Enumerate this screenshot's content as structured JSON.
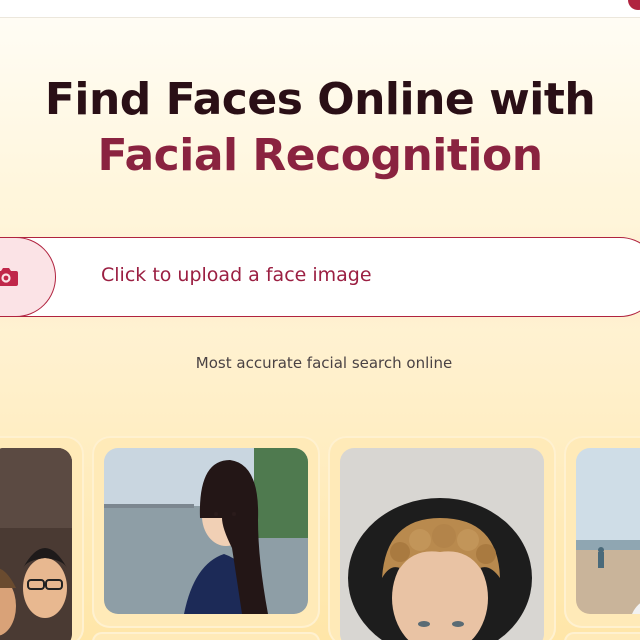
{
  "hero": {
    "line1": "Find Faces Online with",
    "line2": "Facial Recognition"
  },
  "upload": {
    "icon": "camera-icon",
    "label": "Click to upload a face image"
  },
  "subtitle": "Most accurate facial search online",
  "colors": {
    "accent": "#b0233f",
    "heading_dark": "#2a0f16",
    "heading_accent": "#8a2340"
  },
  "gallery": {
    "photos": [
      {
        "name": "face-photo-1"
      },
      {
        "name": "face-photo-2"
      },
      {
        "name": "face-photo-3"
      },
      {
        "name": "face-photo-4"
      }
    ]
  }
}
